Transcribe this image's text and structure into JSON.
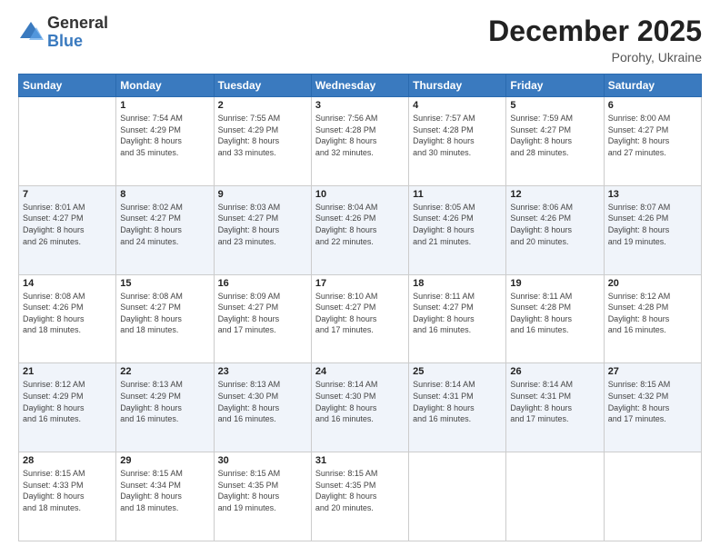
{
  "logo": {
    "general": "General",
    "blue": "Blue"
  },
  "title": "December 2025",
  "location": "Porohy, Ukraine",
  "days_header": [
    "Sunday",
    "Monday",
    "Tuesday",
    "Wednesday",
    "Thursday",
    "Friday",
    "Saturday"
  ],
  "weeks": [
    [
      {
        "day": "",
        "info": ""
      },
      {
        "day": "1",
        "info": "Sunrise: 7:54 AM\nSunset: 4:29 PM\nDaylight: 8 hours\nand 35 minutes."
      },
      {
        "day": "2",
        "info": "Sunrise: 7:55 AM\nSunset: 4:29 PM\nDaylight: 8 hours\nand 33 minutes."
      },
      {
        "day": "3",
        "info": "Sunrise: 7:56 AM\nSunset: 4:28 PM\nDaylight: 8 hours\nand 32 minutes."
      },
      {
        "day": "4",
        "info": "Sunrise: 7:57 AM\nSunset: 4:28 PM\nDaylight: 8 hours\nand 30 minutes."
      },
      {
        "day": "5",
        "info": "Sunrise: 7:59 AM\nSunset: 4:27 PM\nDaylight: 8 hours\nand 28 minutes."
      },
      {
        "day": "6",
        "info": "Sunrise: 8:00 AM\nSunset: 4:27 PM\nDaylight: 8 hours\nand 27 minutes."
      }
    ],
    [
      {
        "day": "7",
        "info": "Sunrise: 8:01 AM\nSunset: 4:27 PM\nDaylight: 8 hours\nand 26 minutes."
      },
      {
        "day": "8",
        "info": "Sunrise: 8:02 AM\nSunset: 4:27 PM\nDaylight: 8 hours\nand 24 minutes."
      },
      {
        "day": "9",
        "info": "Sunrise: 8:03 AM\nSunset: 4:27 PM\nDaylight: 8 hours\nand 23 minutes."
      },
      {
        "day": "10",
        "info": "Sunrise: 8:04 AM\nSunset: 4:26 PM\nDaylight: 8 hours\nand 22 minutes."
      },
      {
        "day": "11",
        "info": "Sunrise: 8:05 AM\nSunset: 4:26 PM\nDaylight: 8 hours\nand 21 minutes."
      },
      {
        "day": "12",
        "info": "Sunrise: 8:06 AM\nSunset: 4:26 PM\nDaylight: 8 hours\nand 20 minutes."
      },
      {
        "day": "13",
        "info": "Sunrise: 8:07 AM\nSunset: 4:26 PM\nDaylight: 8 hours\nand 19 minutes."
      }
    ],
    [
      {
        "day": "14",
        "info": "Sunrise: 8:08 AM\nSunset: 4:26 PM\nDaylight: 8 hours\nand 18 minutes."
      },
      {
        "day": "15",
        "info": "Sunrise: 8:08 AM\nSunset: 4:27 PM\nDaylight: 8 hours\nand 18 minutes."
      },
      {
        "day": "16",
        "info": "Sunrise: 8:09 AM\nSunset: 4:27 PM\nDaylight: 8 hours\nand 17 minutes."
      },
      {
        "day": "17",
        "info": "Sunrise: 8:10 AM\nSunset: 4:27 PM\nDaylight: 8 hours\nand 17 minutes."
      },
      {
        "day": "18",
        "info": "Sunrise: 8:11 AM\nSunset: 4:27 PM\nDaylight: 8 hours\nand 16 minutes."
      },
      {
        "day": "19",
        "info": "Sunrise: 8:11 AM\nSunset: 4:28 PM\nDaylight: 8 hours\nand 16 minutes."
      },
      {
        "day": "20",
        "info": "Sunrise: 8:12 AM\nSunset: 4:28 PM\nDaylight: 8 hours\nand 16 minutes."
      }
    ],
    [
      {
        "day": "21",
        "info": "Sunrise: 8:12 AM\nSunset: 4:29 PM\nDaylight: 8 hours\nand 16 minutes."
      },
      {
        "day": "22",
        "info": "Sunrise: 8:13 AM\nSunset: 4:29 PM\nDaylight: 8 hours\nand 16 minutes."
      },
      {
        "day": "23",
        "info": "Sunrise: 8:13 AM\nSunset: 4:30 PM\nDaylight: 8 hours\nand 16 minutes."
      },
      {
        "day": "24",
        "info": "Sunrise: 8:14 AM\nSunset: 4:30 PM\nDaylight: 8 hours\nand 16 minutes."
      },
      {
        "day": "25",
        "info": "Sunrise: 8:14 AM\nSunset: 4:31 PM\nDaylight: 8 hours\nand 16 minutes."
      },
      {
        "day": "26",
        "info": "Sunrise: 8:14 AM\nSunset: 4:31 PM\nDaylight: 8 hours\nand 17 minutes."
      },
      {
        "day": "27",
        "info": "Sunrise: 8:15 AM\nSunset: 4:32 PM\nDaylight: 8 hours\nand 17 minutes."
      }
    ],
    [
      {
        "day": "28",
        "info": "Sunrise: 8:15 AM\nSunset: 4:33 PM\nDaylight: 8 hours\nand 18 minutes."
      },
      {
        "day": "29",
        "info": "Sunrise: 8:15 AM\nSunset: 4:34 PM\nDaylight: 8 hours\nand 18 minutes."
      },
      {
        "day": "30",
        "info": "Sunrise: 8:15 AM\nSunset: 4:35 PM\nDaylight: 8 hours\nand 19 minutes."
      },
      {
        "day": "31",
        "info": "Sunrise: 8:15 AM\nSunset: 4:35 PM\nDaylight: 8 hours\nand 20 minutes."
      },
      {
        "day": "",
        "info": ""
      },
      {
        "day": "",
        "info": ""
      },
      {
        "day": "",
        "info": ""
      }
    ]
  ]
}
